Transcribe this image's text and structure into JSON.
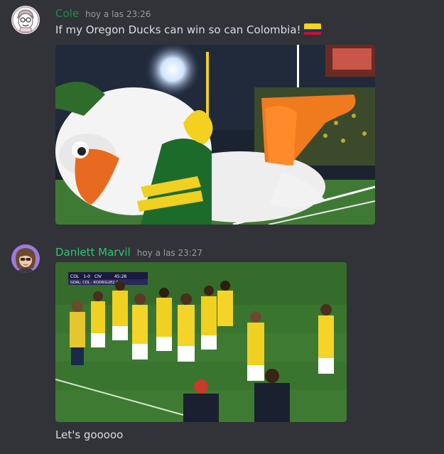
{
  "messages": [
    {
      "author": "Cole",
      "author_color": "#1f8b4c",
      "timestamp": "hoy a las 23:26",
      "text": "If my Oregon Ducks can win so can Colombia!",
      "emoji": "flag-colombia-icon",
      "attachment": "gif-oregon-duck-mascot"
    },
    {
      "author": "Danlett Marvil",
      "author_color": "#2dc770",
      "timestamp": "hoy a las 23:27",
      "attachment": "gif-colombia-players-celebrating",
      "scoreboard": {
        "team_a": "COL",
        "team_b": "CIV",
        "score": "1-0",
        "clock": "45:28",
        "goal": "GOAL: COL - RODRIGUEZ 64'"
      },
      "text": "Let's gooooo"
    }
  ],
  "colors": {
    "background": "#313338",
    "text": "#dbdee1",
    "timestamp": "#949ba4"
  }
}
